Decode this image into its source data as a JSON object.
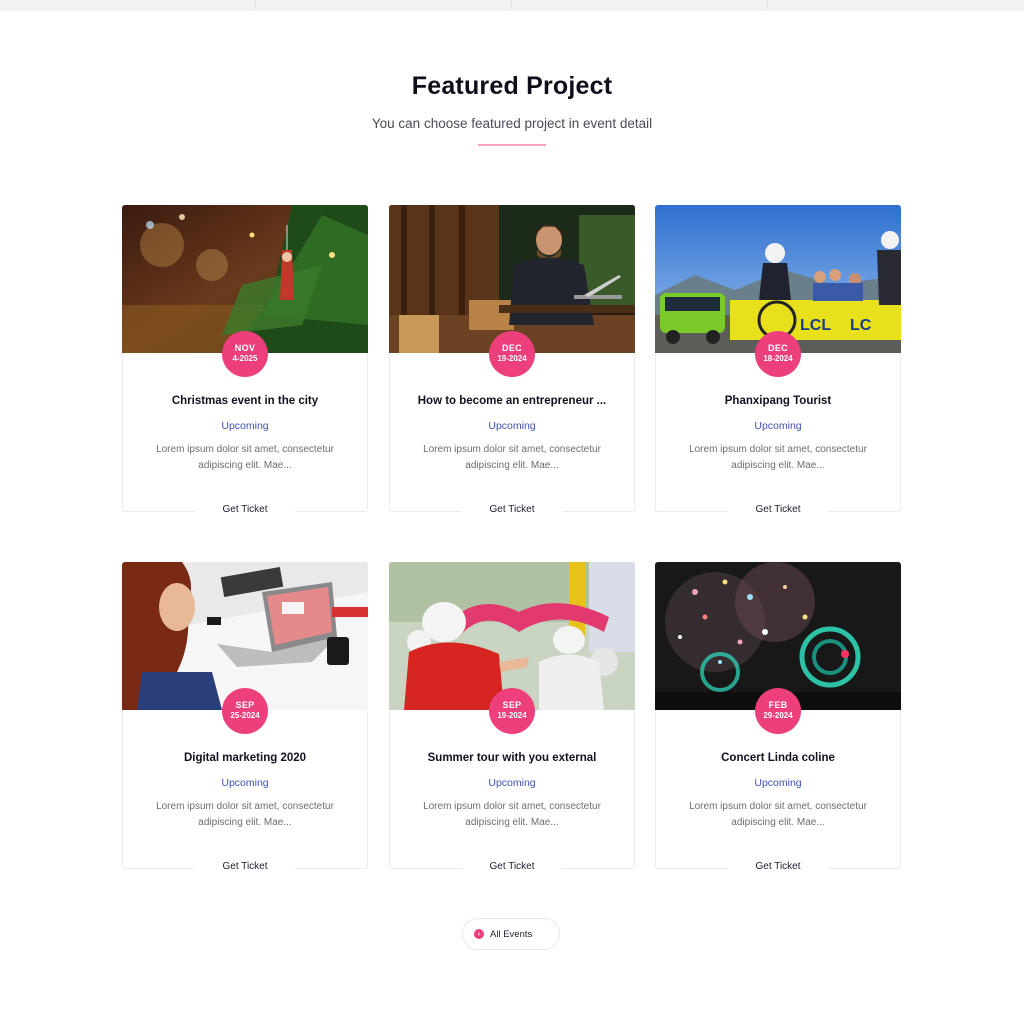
{
  "section": {
    "title": "Featured Project",
    "subtitle": "You can choose featured project in event detail"
  },
  "events": [
    {
      "title": "Christmas event in the city",
      "month": "NOV",
      "date": "4-2025",
      "status": "Upcoming",
      "desc": "Lorem ipsum dolor sit amet, consectetur adipiscing elit. Mae...",
      "ticket": "Get Ticket",
      "image": "christmas-tree-photo"
    },
    {
      "title": "How to become an entrepreneur ...",
      "month": "DEC",
      "date": "19-2024",
      "status": "Upcoming",
      "desc": "Lorem ipsum dolor sit amet, consectetur adipiscing elit. Mae...",
      "ticket": "Get Ticket",
      "image": "businessman-laptop-photo"
    },
    {
      "title": "Phanxipang Tourist",
      "month": "DEC",
      "date": "18-2024",
      "status": "Upcoming",
      "desc": "Lorem ipsum dolor sit amet, consectetur adipiscing elit. Mae...",
      "ticket": "Get Ticket",
      "image": "cyclists-race-photo"
    },
    {
      "title": "Digital marketing 2020",
      "month": "SEP",
      "date": "25-2024",
      "status": "Upcoming",
      "desc": "Lorem ipsum dolor sit amet, consectetur adipiscing elit. Mae...",
      "ticket": "Get Ticket",
      "image": "woman-laptop-photo"
    },
    {
      "title": "Summer tour with you external",
      "month": "SEP",
      "date": "19-2024",
      "status": "Upcoming",
      "desc": "Lorem ipsum dolor sit amet, consectetur adipiscing elit. Mae...",
      "ticket": "Get Ticket",
      "image": "parade-dancers-photo"
    },
    {
      "title": "Concert Linda coline",
      "month": "FEB",
      "date": "29-2024",
      "status": "Upcoming",
      "desc": "Lorem ipsum dolor sit amet, consectetur adipiscing elit. Mae...",
      "ticket": "Get Ticket",
      "image": "concert-confetti-photo"
    }
  ],
  "all_events": {
    "label": "All Events",
    "icon": "chevron-right-icon"
  },
  "colors": {
    "accent": "#ec3f7c",
    "status": "#3f51b5"
  }
}
